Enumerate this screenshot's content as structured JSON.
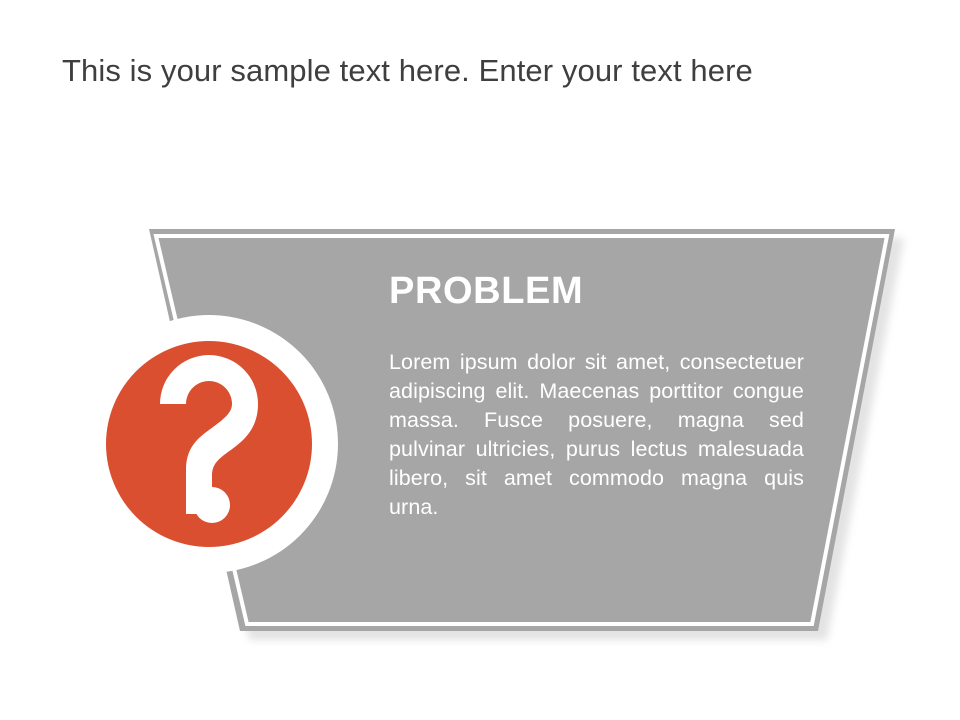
{
  "slide": {
    "title": "This is your sample text here. Enter your text here",
    "background_color": "#ffffff",
    "title_color": "#3f3f3f"
  },
  "panel": {
    "heading": "PROBLEM",
    "body": "Lorem ipsum dolor sit amet, consectetuer adipiscing elit. Maecenas porttitor congue massa. Fusce posuere, magna sed pulvinar ultricies, purus lectus malesuada libero, sit amet commodo magna quis urna.",
    "fill_color": "#a6a6a6",
    "inner_stroke_color": "#ffffff",
    "shadow_color": "#bfbfbf",
    "heading_color": "#ffffff",
    "body_color": "#ffffff"
  },
  "icon": {
    "name": "question-mark-icon",
    "glyph": "?",
    "circle_color": "#db4f31",
    "ring_color": "#ffffff",
    "glyph_color": "#ffffff"
  }
}
